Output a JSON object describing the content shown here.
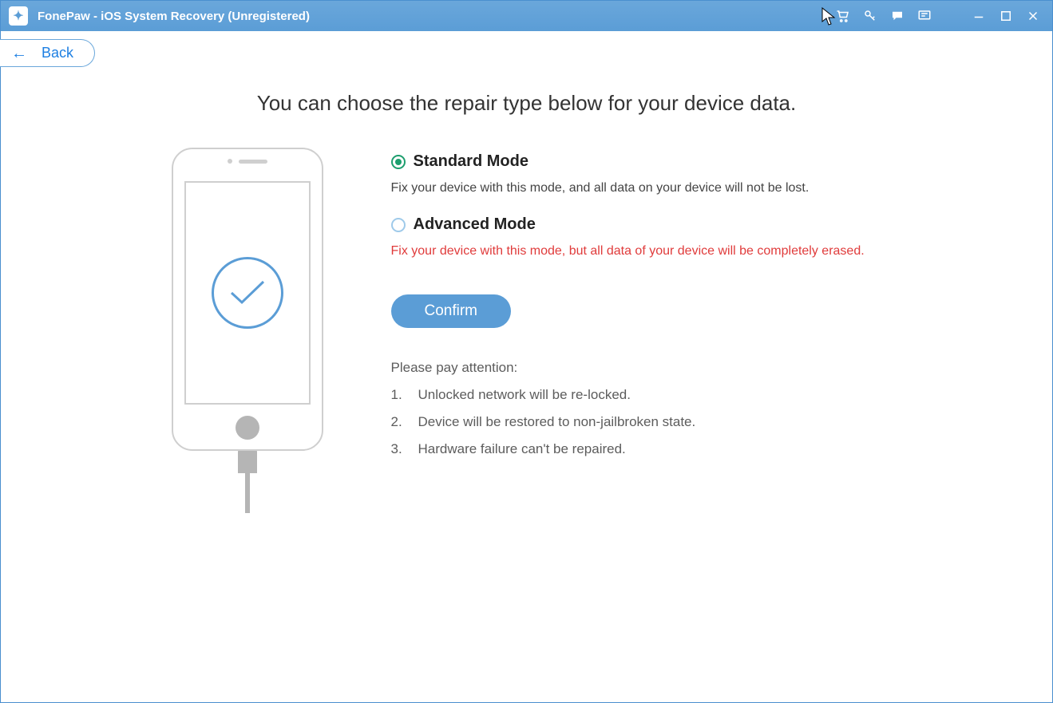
{
  "titlebar": {
    "title": "FonePaw - iOS System Recovery (Unregistered)"
  },
  "nav": {
    "back": "Back"
  },
  "heading": "You can choose the repair type below for your device data.",
  "modes": {
    "standard": {
      "title": "Standard Mode",
      "desc": "Fix your device with this mode, and all data on your device will not be lost."
    },
    "advanced": {
      "title": "Advanced Mode",
      "desc": "Fix your device with this mode, but all data of your device will be completely erased."
    }
  },
  "confirm_label": "Confirm",
  "attention": {
    "title": "Please pay attention:",
    "items": [
      "Unlocked network will be re-locked.",
      "Device will be restored to non-jailbroken state.",
      "Hardware failure can't be repaired."
    ],
    "nums": [
      "1.",
      "2.",
      "3."
    ]
  }
}
